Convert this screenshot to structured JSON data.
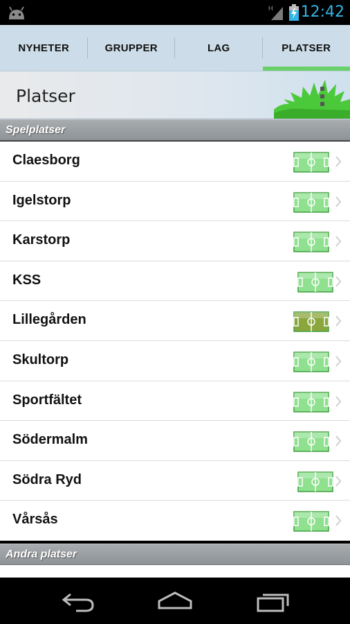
{
  "status_bar": {
    "time": "12:42",
    "network": "H",
    "icons": [
      "android-debug-icon",
      "signal-icon",
      "battery-charging-icon"
    ],
    "time_color": "#33b5e5"
  },
  "tabs": [
    {
      "label": "NYHETER",
      "active": false
    },
    {
      "label": "GRUPPER",
      "active": false
    },
    {
      "label": "LAG",
      "active": false
    },
    {
      "label": "PLATSER",
      "active": true
    }
  ],
  "header": {
    "title": "Platser",
    "menu_icon": "overflow-menu-icon"
  },
  "sections": [
    {
      "title": "Spelplatser",
      "items": [
        {
          "label": "Claesborg",
          "icon": "football-field-icon",
          "chevron": "chevron-right-icon"
        },
        {
          "label": "Igelstorp",
          "icon": "football-field-icon",
          "chevron": "chevron-right-icon"
        },
        {
          "label": "Karstorp",
          "icon": "football-field-icon",
          "chevron": "chevron-right-icon"
        },
        {
          "label": "KSS",
          "icon": "football-field-icon",
          "chevron": "chevron-right-icon"
        },
        {
          "label": "Lillegården",
          "icon": "football-field-icon",
          "chevron": "chevron-right-icon",
          "variant": "dark"
        },
        {
          "label": "Skultorp",
          "icon": "football-field-icon",
          "chevron": "chevron-right-icon"
        },
        {
          "label": "Sportfältet",
          "icon": "football-field-icon",
          "chevron": "chevron-right-icon"
        },
        {
          "label": "Södermalm",
          "icon": "football-field-icon",
          "chevron": "chevron-right-icon"
        },
        {
          "label": "Södra Ryd",
          "icon": "football-field-icon",
          "chevron": "chevron-right-icon"
        },
        {
          "label": "Vårsås",
          "icon": "football-field-icon",
          "chevron": "chevron-right-icon"
        }
      ]
    },
    {
      "title": "Andra platser",
      "items": []
    }
  ],
  "nav_bar": {
    "buttons": [
      "back-icon",
      "home-icon",
      "recent-apps-icon"
    ]
  },
  "colors": {
    "accent": "#6ad06a",
    "tab_bg": "#ccdde9",
    "field_light": "#8fe08f",
    "field_dark": "#8aa63c"
  }
}
